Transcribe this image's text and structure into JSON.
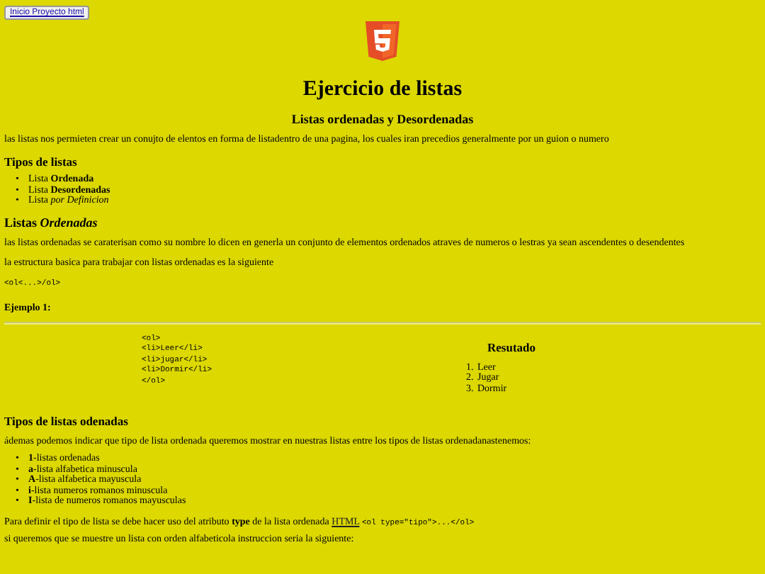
{
  "nav_button": "Inicio Proyecto html",
  "title": "Ejercicio de listas",
  "subtitle": "Listas ordenadas y Desordenadas",
  "intro": "las listas nos permieten crear un conujto de elentos en forma de listadentro de una pagina, los cuales iran precedios generalmente por un guion o numero",
  "types_heading": "Tipos de listas",
  "types": [
    {
      "marker": "•",
      "text": "Lista **Ordenada**"
    },
    {
      "marker": "•",
      "text": "Lista **Desordenadas**"
    },
    {
      "marker": "•",
      "text": "Lista *por Definicion*"
    }
  ],
  "ordered_heading": "Listas *Ordenadas*",
  "ordered_paragraphs": [
    "las listas ordenadas se caraterisan como su nombre lo dicen en generla un conjunto de elementos ordenados atraves de numeros o lestras ya sean ascendentes o desendentes",
    "la estructura basica para trabajar con listas ordenadas es la siguiente"
  ],
  "basic_code": "<ol<...>/ol>",
  "example_label": "Ejemplo 1:",
  "example": {
    "code_lines": [
      "<ol>",
      "<li>Leer</li>",
      "<li>jugar</li>",
      "<li>Dormir</li>",
      "</ol>"
    ],
    "result_heading": "Resutado",
    "result_items": [
      {
        "marker": "1.",
        "text": "Leer"
      },
      {
        "marker": "2.",
        "text": "Jugar"
      },
      {
        "marker": "3.",
        "text": "Dormir"
      }
    ]
  },
  "ordered_types_heading": "Tipos de listas odenadas",
  "ordered_types_intro": "ádemas podemos indicar que tipo de lista ordenada queremos mostrar en nuestras listas entre los tipos de listas ordenadanastenemos:",
  "ordered_types": [
    {
      "marker": "•",
      "text": "**1**-listas ordenadas"
    },
    {
      "marker": "•",
      "text": "**a**-lista alfabetica minuscula"
    },
    {
      "marker": "•",
      "text": "**A**-lista alfabetica mayuscula"
    },
    {
      "marker": "•",
      "text": "**i**-lista numeros romanos minuscula"
    },
    {
      "marker": "•",
      "text": "**I**-lista de numeros romanos mayusculas"
    }
  ],
  "definition": {
    "text": "Para definir el tipo de lista se debe hacer uso del atributo **type** de la lista ordenada",
    "link": "HTML",
    "code": "<ol type=\"tipo\">...</ol>"
  },
  "closing": "si queremos que se muestre un lista con orden alfabeticola instruccion seria la siguiente:"
}
